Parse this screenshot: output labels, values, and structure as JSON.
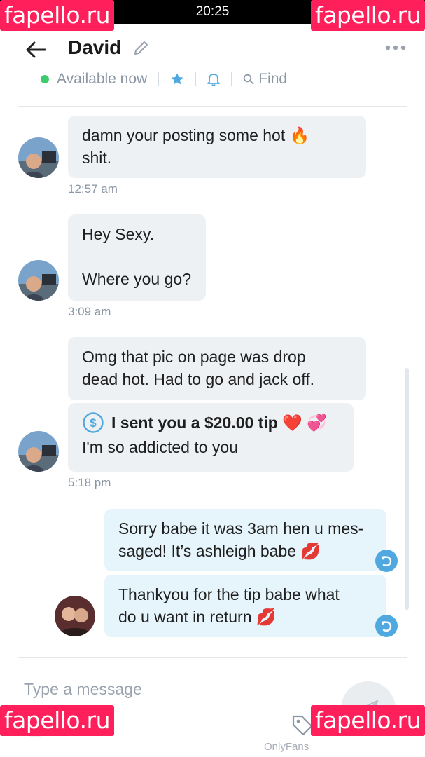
{
  "status_bar": {
    "time": "20:25"
  },
  "watermark": {
    "text": "fapello.ru"
  },
  "header": {
    "contact_name": "David",
    "status": "Available now",
    "find_label": "Find"
  },
  "messages": [
    {
      "lines": [
        "damn your posting some hot 🔥",
        "shit."
      ],
      "time": "12:57 am"
    },
    {
      "lines": [
        "Hey Sexy.",
        "",
        "Where you go?"
      ],
      "time": "3:09 am"
    },
    {
      "lines": [
        "Omg that pic on page was drop",
        "dead hot. Had to go and jack off."
      ]
    },
    {
      "tip": "I sent you a $20.00 tip ❤️ 💞",
      "text": "I'm so addicted to you",
      "time": "5:18 pm"
    },
    {
      "lines": [
        "Sorry babe it was 3am hen u mes-",
        "saged! It’s ashleigh babe 💋"
      ]
    },
    {
      "lines": [
        "Thankyou for the tip babe what",
        "do u want in return 💋"
      ]
    }
  ],
  "composer": {
    "placeholder": "Type a message"
  },
  "footer": {
    "brand": "OnlyFans"
  },
  "colors": {
    "accent": "#4fa9e0",
    "online": "#3ecb6e",
    "watermark": "#ff1f5a"
  }
}
